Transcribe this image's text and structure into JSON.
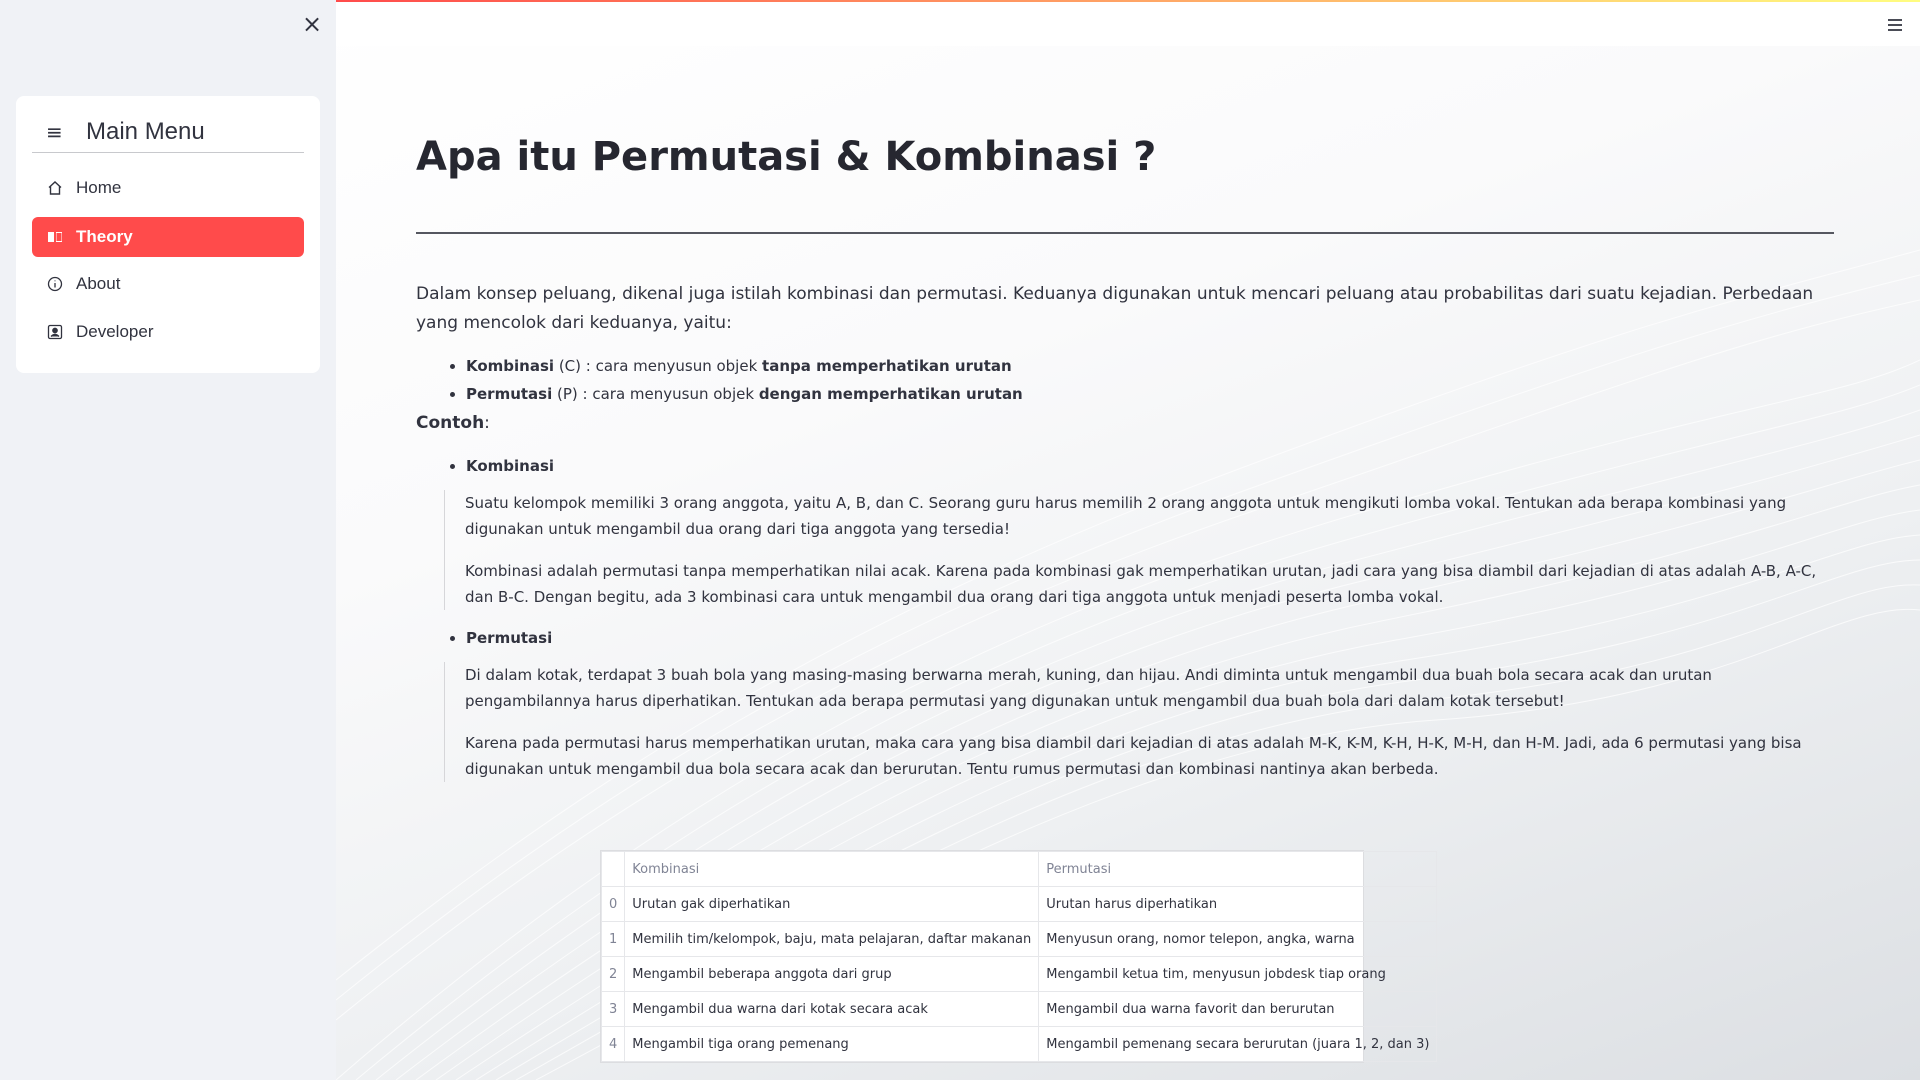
{
  "sidebar": {
    "close_icon": "×",
    "menu_title": "Main Menu",
    "items": [
      {
        "label": "Home",
        "icon": "house-icon",
        "active": false
      },
      {
        "label": "Theory",
        "icon": "book-icon",
        "active": true
      },
      {
        "label": "About",
        "icon": "info-icon",
        "active": false
      },
      {
        "label": "Developer",
        "icon": "person-badge-icon",
        "active": false
      }
    ],
    "active_color": "#ff4b4b"
  },
  "main": {
    "title": "Apa itu Permutasi & Kombinasi ?",
    "intro": "Dalam konsep peluang, dikenal juga istilah kombinasi dan permutasi. Keduanya digunakan untuk mencari peluang atau probabilitas dari suatu kejadian. Perbedaan yang mencolok dari keduanya, yaitu:",
    "definitions": [
      {
        "term": "Kombinasi",
        "symbol": " (C) : cara menyusun objek ",
        "emphasis": "tanpa memperhatikan urutan"
      },
      {
        "term": "Permutasi",
        "symbol": " (P) : cara menyusun objek ",
        "emphasis": "dengan memperhatikan urutan"
      }
    ],
    "contoh_label": "Contoh",
    "contoh_suffix": ":",
    "examples": [
      {
        "heading": "Kombinasi",
        "paragraphs": [
          "Suatu kelompok memiliki 3 orang anggota, yaitu A, B, dan C. Seorang guru harus memilih 2 orang anggota untuk mengikuti lomba vokal. Tentukan ada berapa kombinasi yang digunakan untuk mengambil dua orang dari tiga anggota yang tersedia!",
          "Kombinasi adalah permutasi tanpa memperhatikan nilai acak. Karena pada kombinasi gak memperhatikan urutan, jadi cara yang bisa diambil dari kejadian di atas adalah A-B, A-C, dan B-C. Dengan begitu, ada 3 kombinasi cara untuk mengambil dua orang dari tiga anggota untuk menjadi peserta lomba vokal."
        ]
      },
      {
        "heading": "Permutasi",
        "paragraphs": [
          "Di dalam kotak, terdapat 3 buah bola yang masing-masing berwarna merah, kuning, dan hijau. Andi diminta untuk mengambil dua buah bola secara acak dan urutan pengambilannya harus diperhatikan. Tentukan ada berapa permutasi yang digunakan untuk mengambil dua buah bola dari dalam kotak tersebut!",
          "Karena pada permutasi harus memperhatikan urutan, maka cara yang bisa diambil dari kejadian di atas adalah M-K, K-M, K-H, H-K, M-H, dan H-M. Jadi, ada 6 permutasi yang bisa digunakan untuk mengambil dua bola secara acak dan berurutan. Tentu rumus permutasi dan kombinasi nantinya akan berbeda."
        ]
      }
    ],
    "table": {
      "columns": [
        "",
        "Kombinasi",
        "Permutasi"
      ],
      "rows": [
        [
          "0",
          "Urutan gak diperhatikan",
          "Urutan harus diperhatikan"
        ],
        [
          "1",
          "Memilih tim/kelompok, baju, mata pelajaran, daftar makanan",
          "Menyusun orang, nomor telepon, angka, warna"
        ],
        [
          "2",
          "Mengambil beberapa anggota dari grup",
          "Mengambil ketua tim, menyusun jobdesk tiap orang"
        ],
        [
          "3",
          "Mengambil dua warna dari kotak secara acak",
          "Mengambil dua warna favorit dan berurutan"
        ],
        [
          "4",
          "Mengambil tiga orang pemenang",
          "Mengambil pemenang secara berurutan (juara 1, 2, dan 3)"
        ]
      ]
    }
  }
}
